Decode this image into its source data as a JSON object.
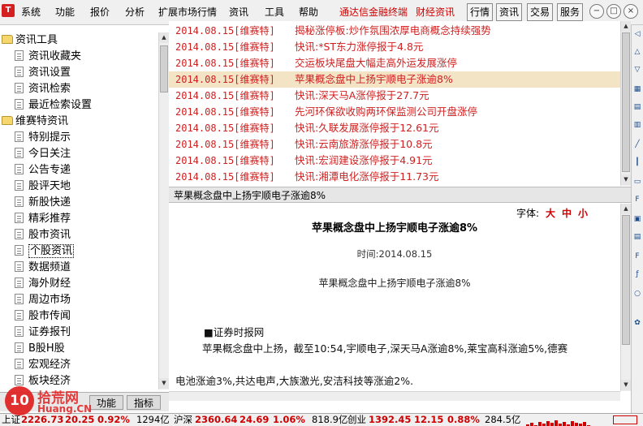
{
  "menubar": {
    "items": [
      "系统",
      "功能",
      "报价",
      "分析",
      "扩展市场行情",
      "资讯",
      "工具",
      "帮助"
    ],
    "red_items": [
      "通达信金融终端",
      "财经资讯"
    ],
    "toolbar_buttons": [
      "行情",
      "资讯",
      "交易",
      "服务"
    ]
  },
  "tree": {
    "folders": [
      {
        "label": "资讯工具",
        "items": [
          "资讯收藏夹",
          "资讯设置",
          "资讯检索",
          "最近检索设置"
        ]
      },
      {
        "label": "维赛特资讯",
        "items": [
          "特别提示",
          "今日关注",
          "公告专递",
          "股评天地",
          "新股快递",
          "精彩推荐",
          "股市资讯",
          "个股资讯",
          "数据频道",
          "海外财经",
          "周边市场",
          "股市传闻",
          "证券报刊",
          "B股H股",
          "宏观经济",
          "板块经济"
        ]
      }
    ],
    "selected": "个股资讯"
  },
  "left_tabs": [
    "功能",
    "指标"
  ],
  "news": {
    "rows": [
      {
        "date": "2014.08.15[维赛特]",
        "title": "揭秘涨停板:炒作氛围浓厚电商概念持续强势"
      },
      {
        "date": "2014.08.15[维赛特]",
        "title": "快讯:*ST东力涨停报于4.8元"
      },
      {
        "date": "2014.08.15[维赛特]",
        "title": "交运板块尾盘大幅走高外运发展涨停"
      },
      {
        "date": "2014.08.15[维赛特]",
        "title": "苹果概念盘中上扬宇顺电子涨逾8%"
      },
      {
        "date": "2014.08.15[维赛特]",
        "title": "快讯:深天马A涨停报于27.7元"
      },
      {
        "date": "2014.08.15[维赛特]",
        "title": "先河环保欲收购两环保监测公司开盘涨停"
      },
      {
        "date": "2014.08.15[维赛特]",
        "title": "快讯:久联发展涨停报于12.61元"
      },
      {
        "date": "2014.08.15[维赛特]",
        "title": "快讯:云南旅游涨停报于10.8元"
      },
      {
        "date": "2014.08.15[维赛特]",
        "title": "快讯:宏润建设涨停报于4.91元"
      },
      {
        "date": "2014.08.15[维赛特]",
        "title": "快讯:湘潭电化涨停报于11.73元"
      }
    ],
    "selected_index": 3
  },
  "article": {
    "header": "苹果概念盘中上扬宇顺电子涨逾8%",
    "font_label": "字体:",
    "font_sizes": [
      "大",
      "中",
      "小"
    ],
    "title": "苹果概念盘中上扬宇顺电子涨逾8%",
    "time": "时间:2014.08.15",
    "subtitle": "苹果概念盘中上扬宇顺电子涨逾8%",
    "source": "■证券时报网",
    "para1": "苹果概念盘中上扬，截至10:54,宇顺电子,深天马A涨逾8%,莱宝高科涨逾5%,德赛",
    "para2": "电池涨逾3%,共达电声,大族激光,安洁科技等涨逾2%."
  },
  "statusbar": {
    "sh_label": "上证",
    "sh_value": "2226.73",
    "sh_change": "20.25",
    "sh_pct": "0.92%",
    "sh_vol": "1294亿",
    "hs_label": "沪深",
    "hs_value": "2360.64",
    "hs_change": "24.69",
    "hs_pct": "1.06%",
    "hs_vol": "818.9亿",
    "cy_label": "创业",
    "cy_value": "1392.45",
    "cy_change": "12.15",
    "cy_pct": "0.88%",
    "cy_vol": "284.5亿"
  },
  "watermark": {
    "badge": "10",
    "text": "拾荒网",
    "url": "Huang.CN"
  },
  "colors": {
    "news_red": "#d02020",
    "selected_row": "#f3e4c6",
    "menu_red": "#d00000"
  }
}
